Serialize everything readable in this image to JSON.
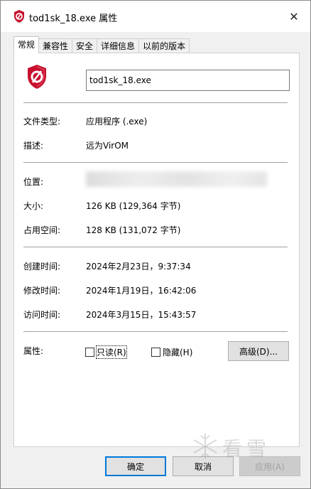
{
  "window": {
    "title": "tod1sk_18.exe 属性",
    "close_glyph": "✕"
  },
  "tabs": [
    {
      "label": "常规",
      "active": true
    },
    {
      "label": "兼容性",
      "active": false
    },
    {
      "label": "安全",
      "active": false
    },
    {
      "label": "详细信息",
      "active": false
    },
    {
      "label": "以前的版本",
      "active": false
    }
  ],
  "file": {
    "name": "tod1sk_18.exe",
    "icon": "shield-app-icon",
    "icon_color": "#c8102e"
  },
  "info": {
    "type_label": "文件类型:",
    "type_value": "应用程序 (.exe)",
    "desc_label": "描述:",
    "desc_value": "远为VirOM",
    "location_label": "位置:",
    "size_label": "大小:",
    "size_value": "126 KB (129,364 字节)",
    "disk_label": "占用空间:",
    "disk_value": "128 KB (131,072 字节)",
    "created_label": "创建时间:",
    "created_value": "2024年2月23日，9:37:34",
    "modified_label": "修改时间:",
    "modified_value": "2024年1月19日，16:42:06",
    "accessed_label": "访问时间:",
    "accessed_value": "2024年3月15日，15:43:57"
  },
  "attributes": {
    "label": "属性:",
    "readonly_label": "只读(R)",
    "readonly_checked": false,
    "hidden_label": "隐藏(H)",
    "hidden_checked": false,
    "advanced_label": "高级(D)..."
  },
  "buttons": {
    "ok": "确定",
    "cancel": "取消",
    "apply": "应用(A)"
  },
  "watermark": {
    "text": "看雪"
  },
  "colors": {
    "accent": "#0078d7",
    "window_bg": "#f0f0f0"
  }
}
